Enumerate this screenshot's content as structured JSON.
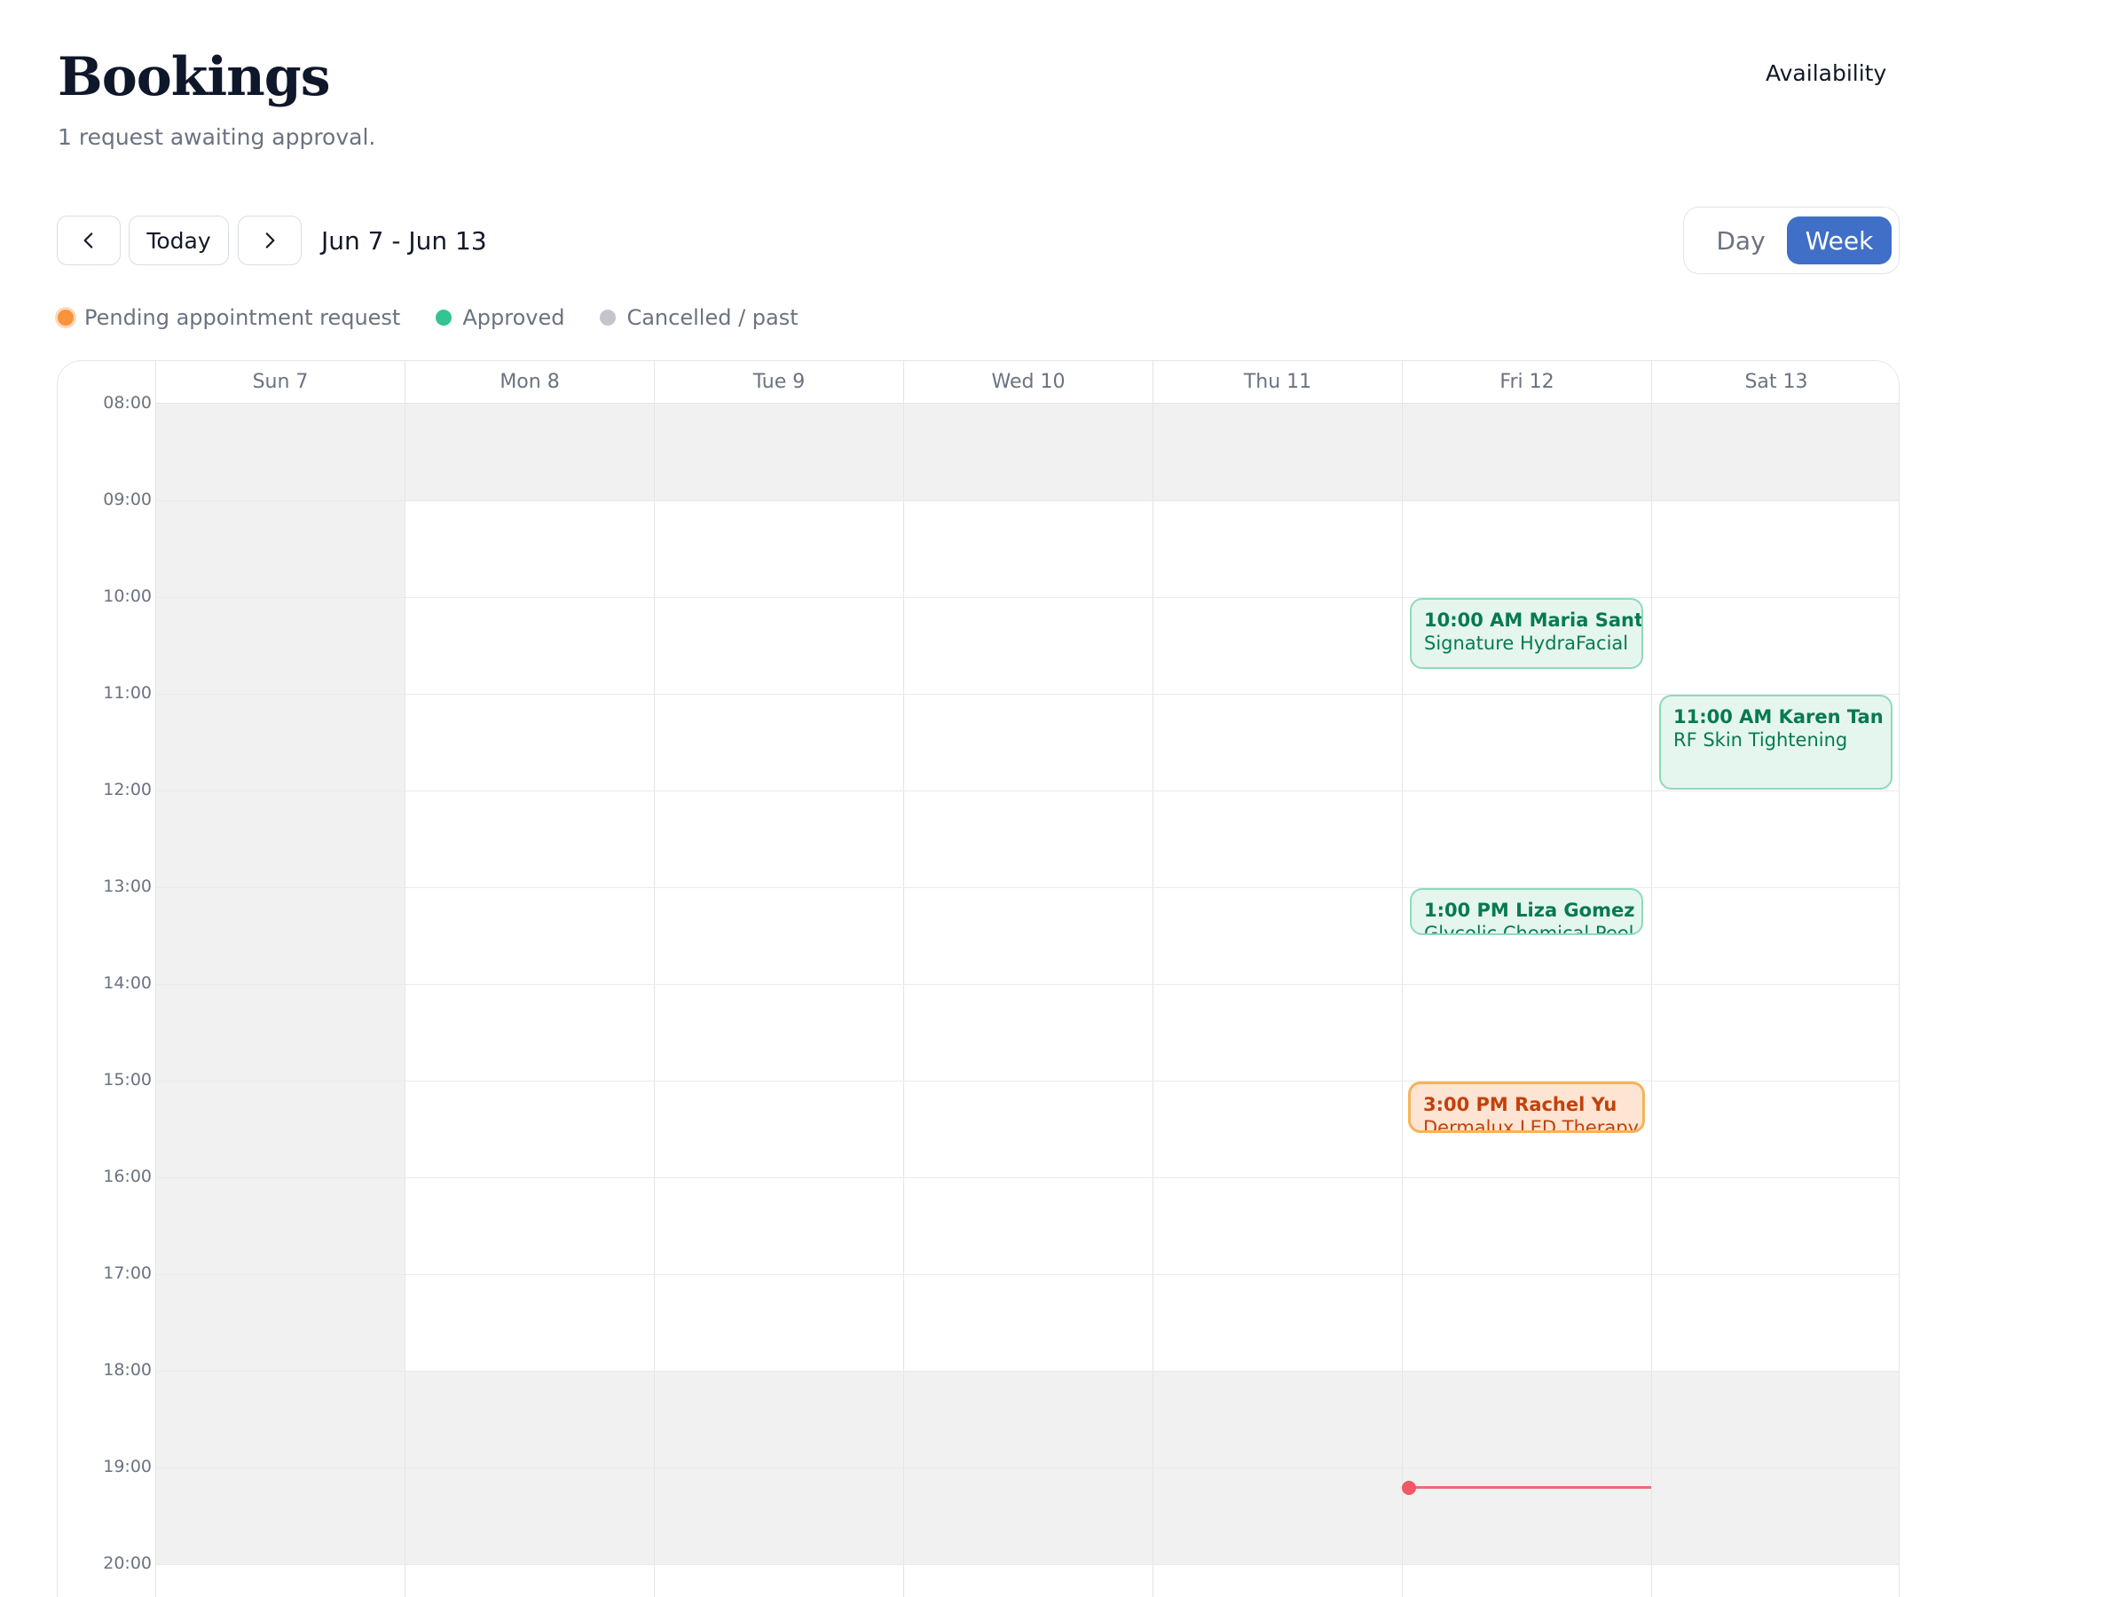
{
  "header": {
    "title": "Bookings",
    "subtitle": "1 request awaiting approval.",
    "availability_label": "Availability"
  },
  "toolbar": {
    "prev_icon": "chevron-left-icon",
    "today_label": "Today",
    "next_icon": "chevron-right-icon",
    "date_range": "Jun 7 - Jun 13"
  },
  "view_toggle": {
    "day_label": "Day",
    "week_label": "Week",
    "selected": "Week"
  },
  "legend": {
    "items": [
      {
        "label": "Pending appointment request",
        "color": "#fb923c"
      },
      {
        "label": "Approved",
        "color": "#34c393"
      },
      {
        "label": "Cancelled / past",
        "color": "#c2c5ca"
      }
    ]
  },
  "calendar": {
    "days": [
      {
        "label": "Sun 7",
        "closed": true
      },
      {
        "label": "Mon 8",
        "closed": false
      },
      {
        "label": "Tue 9",
        "closed": false
      },
      {
        "label": "Wed 10",
        "closed": false
      },
      {
        "label": "Thu 11",
        "closed": false
      },
      {
        "label": "Fri 12",
        "closed": false
      },
      {
        "label": "Sat 13",
        "closed": false
      }
    ],
    "hours": [
      "08:00",
      "09:00",
      "10:00",
      "11:00",
      "12:00",
      "13:00",
      "14:00",
      "15:00",
      "16:00",
      "17:00",
      "18:00",
      "19:00",
      "20:00"
    ],
    "business_hours": {
      "open": 9,
      "close": 18
    },
    "events": [
      {
        "day": 5,
        "time": "10:00 AM",
        "name": "Maria Santos",
        "service": "Signature HydraFacial",
        "status": "approved",
        "start": 10.0,
        "end": 10.75
      },
      {
        "day": 6,
        "time": "11:00 AM",
        "name": "Karen Tan",
        "service": "RF Skin Tightening",
        "status": "approved",
        "start": 11.0,
        "end": 12.0
      },
      {
        "day": 5,
        "time": "1:00 PM",
        "name": "Liza Gomez",
        "service": "Glycolic Chemical Peel",
        "status": "approved",
        "start": 13.0,
        "end": 13.5
      },
      {
        "day": 5,
        "time": "3:00 PM",
        "name": "Rachel Yu",
        "service": "Dermalux LED Therapy",
        "status": "pending",
        "start": 15.0,
        "end": 15.55
      }
    ],
    "now_indicator": {
      "day": 5,
      "hour": 19.2
    },
    "colors": {
      "approved": "#067a52",
      "pending": "#c2410c",
      "now": "#ef5865",
      "accent": "#3f6fc7"
    }
  }
}
